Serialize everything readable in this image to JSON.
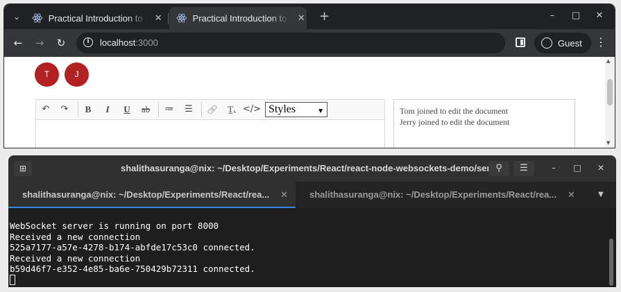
{
  "browser": {
    "tabs": [
      {
        "title": "Practical Introduction to React WebSockets",
        "active": false
      },
      {
        "title": "Practical Introduction to React WebSockets",
        "active": true
      }
    ],
    "new_tab_symbol": "+",
    "window_controls": {
      "minimize": "–",
      "maximize": "□",
      "close": "✕"
    },
    "address": {
      "host": "localhost",
      "port": ":3000"
    },
    "profile_label": "Guest",
    "icons": [
      "tab-search-icon",
      "react-favicon-icon",
      "back-arrow-icon",
      "forward-arrow-icon",
      "reload-icon",
      "info-icon",
      "side-panel-icon",
      "profile-icon",
      "kebab-menu-icon"
    ]
  },
  "page": {
    "avatars": [
      {
        "initial": "T",
        "color": "#b22222"
      },
      {
        "initial": "J",
        "color": "#b22222"
      }
    ],
    "toolbar": {
      "undo": "↶",
      "redo": "↷",
      "bold": "B",
      "italic": "I",
      "underline": "U",
      "strike": "ab",
      "ordered_list": "≔",
      "bullet_list": "☰",
      "link": "🔗",
      "clear_format": "T̲ₓ",
      "code": "</>",
      "styles_value": "Styles"
    },
    "log": [
      "Tom joined to edit the document",
      "Jerry joined to edit the document"
    ]
  },
  "terminal": {
    "title": "shalithasuranga@nix: ~/Desktop/Experiments/React/react-node-websockets-demo/server",
    "tabs": [
      {
        "label": "shalithasuranga@nix: ~/Desktop/Experiments/React/rea...",
        "active": true
      },
      {
        "label": "shalithasuranga@nix: ~/Desktop/Experiments/React/rea...",
        "active": false
      }
    ],
    "output": [
      "WebSocket server is running on port 8000",
      "Received a new connection",
      "525a7177-a57e-4278-b174-abfde17c53c0 connected.",
      "Received a new connection",
      "b59d46f7-e352-4e85-ba6e-750429b72311 connected."
    ],
    "accent": "#3584e4"
  }
}
